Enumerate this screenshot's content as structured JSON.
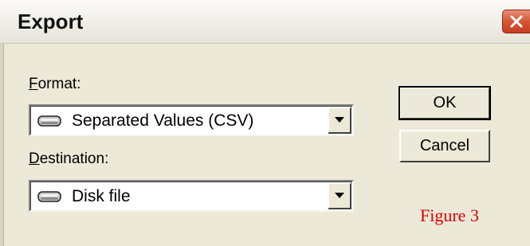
{
  "window": {
    "title": "Export",
    "close_icon": "close-x-icon"
  },
  "format": {
    "label_accel": "F",
    "label_rest": "ormat:",
    "value": "Separated Values (CSV)",
    "icon": "disk-drive-icon"
  },
  "destination": {
    "label_accel": "D",
    "label_rest": "estination:",
    "value": "Disk file",
    "icon": "disk-drive-icon"
  },
  "buttons": {
    "ok_label": "OK",
    "cancel_label": "Cancel"
  },
  "annotation": {
    "text": "Figure 3",
    "color": "#e00000"
  },
  "colors": {
    "dialog_bg": "#ece9d8",
    "close_button": "#d65a3a"
  }
}
